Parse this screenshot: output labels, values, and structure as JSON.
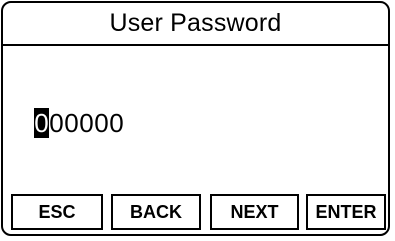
{
  "screen": {
    "title": "User Password"
  },
  "password": {
    "digits": [
      "0",
      "0",
      "0",
      "0",
      "0",
      "0"
    ],
    "cursor_index": 0
  },
  "softkeys": {
    "esc": "ESC",
    "back": "BACK",
    "next": "NEXT",
    "enter": "ENTER"
  }
}
